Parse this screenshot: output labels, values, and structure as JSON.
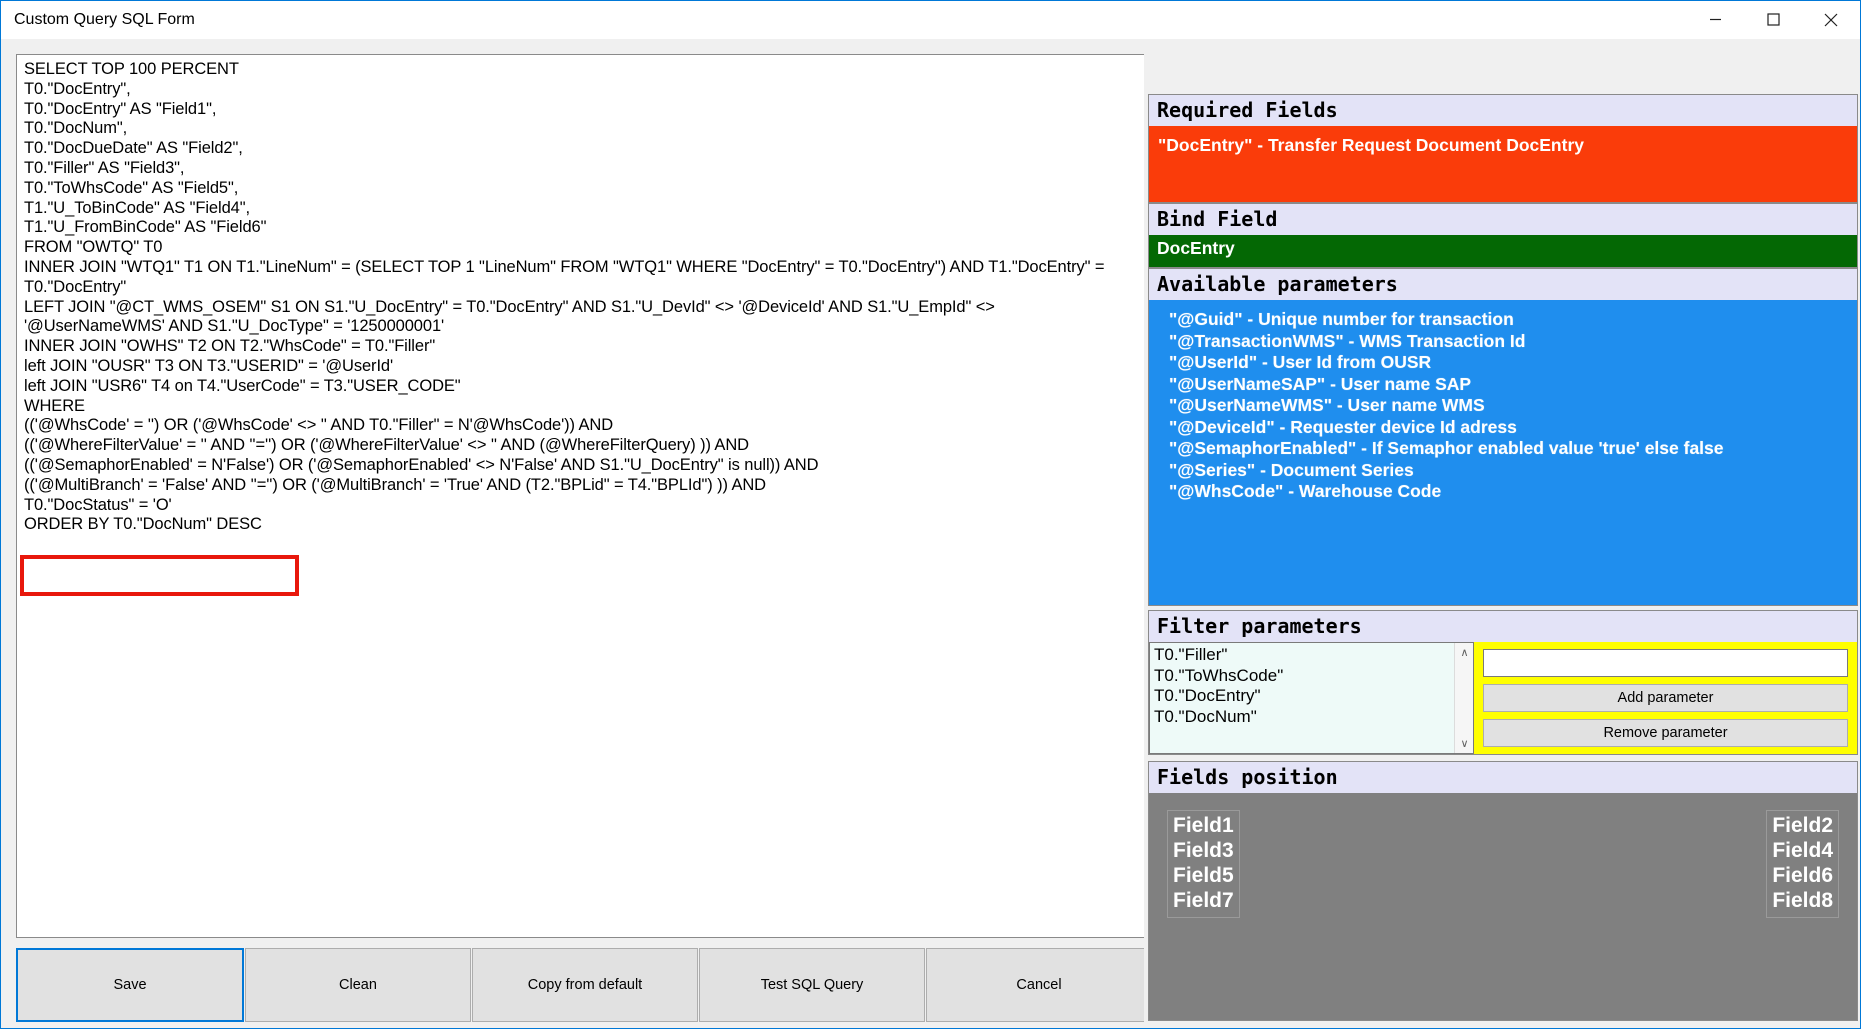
{
  "window": {
    "title": "Custom Query SQL Form",
    "buttons": {
      "minimize": "minimize-icon",
      "maximize": "maximize-icon",
      "close": "close-icon"
    }
  },
  "editor": {
    "sql": "SELECT TOP 100 PERCENT\nT0.\"DocEntry\",\nT0.\"DocEntry\" AS \"Field1\",\nT0.\"DocNum\",\nT0.\"DocDueDate\" AS \"Field2\",\nT0.\"Filler\" AS \"Field3\",\nT0.\"ToWhsCode\" AS \"Field5\",\nT1.\"U_ToBinCode\" AS \"Field4\",\nT1.\"U_FromBinCode\" AS \"Field6\"\nFROM \"OWTQ\" T0\nINNER JOIN \"WTQ1\" T1 ON T1.\"LineNum\" = (SELECT TOP 1 \"LineNum\" FROM \"WTQ1\" WHERE \"DocEntry\" = T0.\"DocEntry\") AND T1.\"DocEntry\" =\nT0.\"DocEntry\"\nLEFT JOIN \"@CT_WMS_OSEM\" S1 ON S1.\"U_DocEntry\" = T0.\"DocEntry\" AND S1.\"U_DevId\" <> '@DeviceId' AND S1.\"U_EmpId\" <>\n'@UserNameWMS' AND S1.\"U_DocType\" = '1250000001'\nINNER JOIN \"OWHS\" T2 ON T2.\"WhsCode\" = T0.\"Filler\"\nleft JOIN \"OUSR\" T3 ON T3.\"USERID\" = '@UserId'\nleft JOIN \"USR6\" T4 on T4.\"UserCode\" = T3.\"USER_CODE\"\nWHERE\n(('@WhsCode' = '') OR ('@WhsCode' <> '' AND T0.\"Filler\" = N'@WhsCode')) AND\n(('@WhereFilterValue' = '' AND ''='') OR ('@WhereFilterValue' <> '' AND (@WhereFilterQuery) )) AND\n(('@SemaphorEnabled' = N'False') OR ('@SemaphorEnabled' <> N'False' AND S1.\"U_DocEntry\" is null)) AND\n(('@MultiBranch' = 'False' AND ''='') OR ('@MultiBranch' = 'True' AND (T2.\"BPLid\" = T4.\"BPLId\") )) AND\nT0.\"DocStatus\" = 'O'\nORDER BY T0.\"DocNum\" DESC",
    "highlight_color": "#e8180c"
  },
  "form_buttons": [
    {
      "label": "Save",
      "name": "save-button",
      "primary": true
    },
    {
      "label": "Clean",
      "name": "clean-button",
      "primary": false
    },
    {
      "label": "Copy from default",
      "name": "copy-from-default-button",
      "primary": false
    },
    {
      "label": "Test SQL Query",
      "name": "test-sql-query-button",
      "primary": false
    },
    {
      "label": "Cancel",
      "name": "cancel-button",
      "primary": false
    }
  ],
  "required_fields": {
    "header": "Required Fields",
    "items": [
      "\"DocEntry\" - Transfer Request Document DocEntry"
    ],
    "bg_color": "#fa3c0a"
  },
  "bind_field": {
    "header": "Bind Field",
    "value": "DocEntry",
    "bg_color": "#046804"
  },
  "available_parameters": {
    "header": "Available parameters",
    "bg_color": "#1f8eee",
    "items": [
      "\"@Guid\" - Unique number for transaction",
      "\"@TransactionWMS\" - WMS Transaction Id",
      "\"@UserId\" - User Id from OUSR",
      "\"@UserNameSAP\" - User name SAP",
      "\"@UserNameWMS\" - User name WMS",
      "\"@DeviceId\" - Requester device Id adress",
      "\"@SemaphorEnabled\" - If Semaphor enabled value 'true' else false",
      "\"@Series\" - Document Series",
      "\"@WhsCode\" - Warehouse Code"
    ]
  },
  "filter_parameters": {
    "header": "Filter parameters",
    "list": [
      "T0.\"Filler\"",
      "T0.\"ToWhsCode\"",
      "T0.\"DocEntry\"",
      "T0.\"DocNum\""
    ],
    "input_value": "",
    "input_placeholder": "",
    "add_label": "Add parameter",
    "remove_label": "Remove parameter",
    "panel_color": "#ffff00",
    "scroll_up": "∧",
    "scroll_down": "∨"
  },
  "fields_position": {
    "header": "Fields position",
    "left_column": [
      "Field1",
      "Field3",
      "Field5",
      "Field7"
    ],
    "right_column": [
      "Field2",
      "Field4",
      "Field6",
      "Field8"
    ],
    "bg_color": "#808080"
  }
}
